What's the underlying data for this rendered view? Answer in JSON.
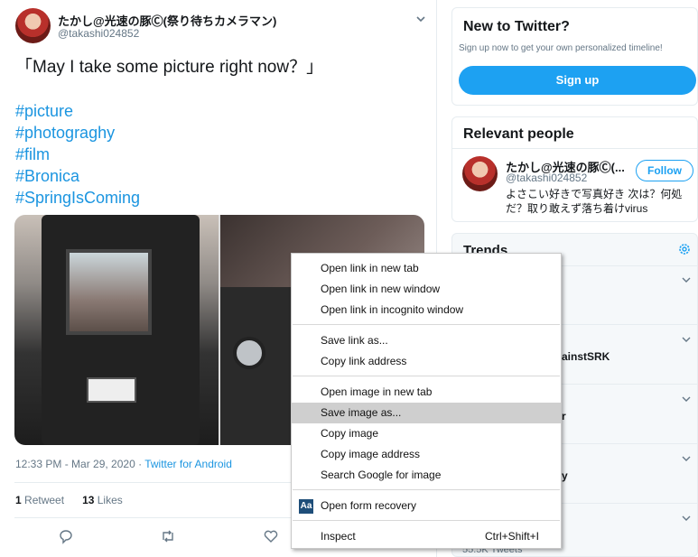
{
  "tweet": {
    "author_name": "たかし@光速の豚Ⓒ(祭り待ちカメラマン)",
    "author_handle": "@takashi024852",
    "text": "「May I take some picture right now？」",
    "hashtags": [
      "#picture",
      "#photograghy",
      "#film",
      "#Bronica",
      "#SpringIsComing"
    ],
    "timestamp": "12:33 PM - Mar 29, 2020 · ",
    "source": "Twitter for Android",
    "retweet_count": "1",
    "retweet_label": " Retweet",
    "like_count": "13",
    "like_label": " Likes"
  },
  "sidebar": {
    "signup": {
      "title": "New to Twitter?",
      "blurb": "Sign up now to get your own personalized timeline!",
      "button": "Sign up"
    },
    "relevant": {
      "title": "Relevant people",
      "name": "たかし@光速の豚Ⓒ(...",
      "handle": "@takashi024852",
      "follow": "Follow",
      "bio": "よさこい好きで写真好き 次は？何処だ？取り敢えず落ち着けvirus"
    },
    "trends": {
      "title": "Trends",
      "fragments": [
        "ainstSRK",
        "r",
        "y"
      ],
      "tweet_count": "55.5K Tweets"
    }
  },
  "context_menu": {
    "items": [
      {
        "label": "Open link in new tab"
      },
      {
        "label": "Open link in new window"
      },
      {
        "label": "Open link in incognito window"
      },
      {
        "label": "Save link as..."
      },
      {
        "label": "Copy link address"
      },
      {
        "label": "Open image in new tab"
      },
      {
        "label": "Save image as...",
        "highlighted": true
      },
      {
        "label": "Copy image"
      },
      {
        "label": "Copy image address"
      },
      {
        "label": "Search Google for image"
      },
      {
        "label": "Open form recovery",
        "icon": "form-recovery-icon"
      },
      {
        "label": "Inspect",
        "shortcut": "Ctrl+Shift+I"
      }
    ],
    "form_icon_text": "Aa"
  },
  "colors": {
    "accent": "#1da1f2",
    "link": "#1b95e0",
    "muted": "#657786",
    "highlight": "#cfcfcf"
  }
}
